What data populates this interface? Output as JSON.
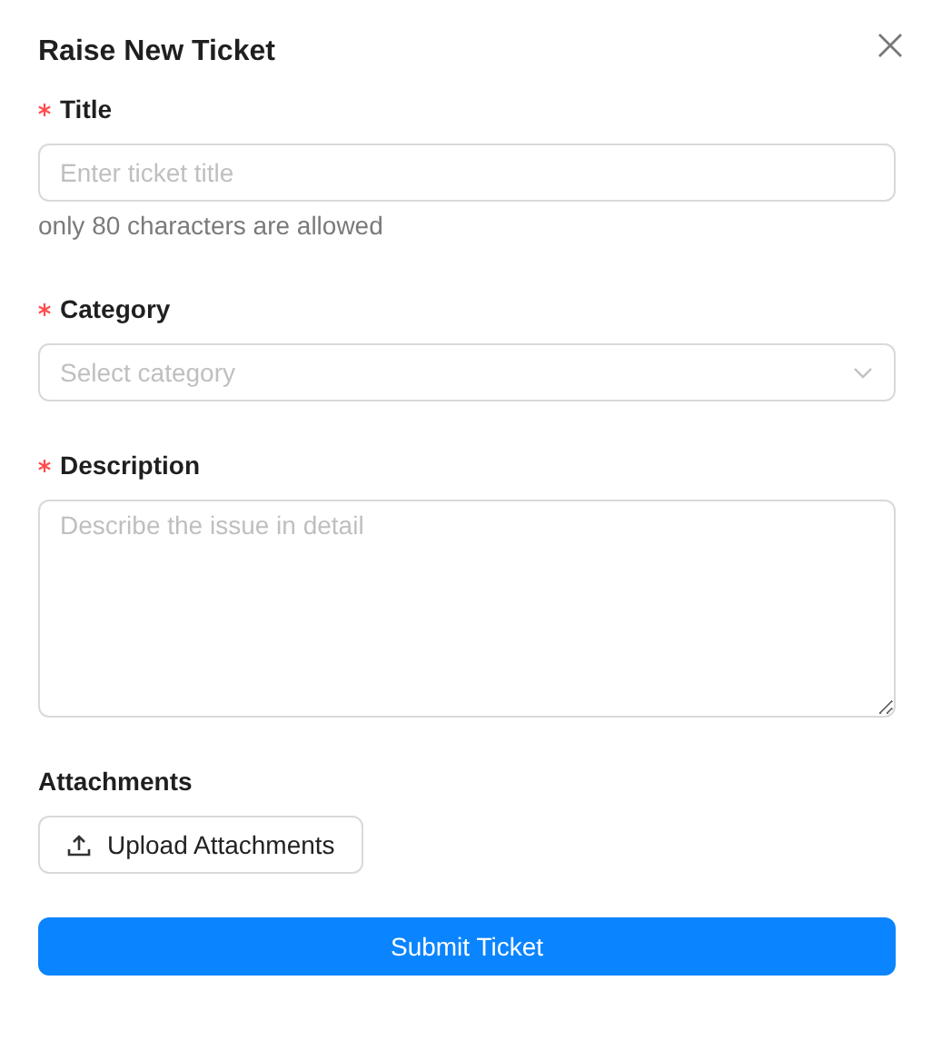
{
  "dialog": {
    "title": "Raise New Ticket"
  },
  "fields": [
    {
      "kind": "input",
      "label": "Title",
      "required": true,
      "placeholder": "Enter ticket title",
      "hint": "only 80 characters are allowed"
    },
    {
      "kind": "select",
      "label": "Category",
      "required": true,
      "placeholder": "Select category"
    },
    {
      "kind": "textarea",
      "label": "Description",
      "required": true,
      "placeholder": "Describe the issue in detail"
    },
    {
      "kind": "upload",
      "label": "Attachments",
      "required": false,
      "button": "Upload Attachments"
    }
  ],
  "submit": "Submit Ticket"
}
